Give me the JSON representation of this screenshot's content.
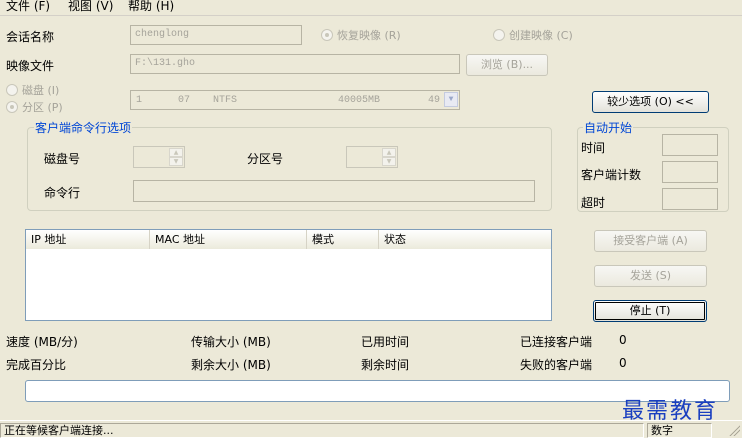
{
  "menu": {
    "file": "文件 (F)",
    "view": "视图 (V)",
    "help": "帮助 (H)"
  },
  "session": {
    "label": "会话名称",
    "value": "chenglong",
    "restore_radio": "恢复映像 (R)",
    "create_radio": "创建映像 (C)"
  },
  "image_file": {
    "label": "映像文件",
    "value": "F:\\131.gho",
    "browse_button": "浏览 (B)..."
  },
  "target": {
    "disk_radio": "磁盘 (I)",
    "partition_radio": "分区 (P)",
    "selection": {
      "index": "1",
      "part": "07",
      "fs": "NTFS",
      "size": "40005MB",
      "extra": "49"
    }
  },
  "less_options_button": "较少选项 (O) <<",
  "client_cmd_group": {
    "title": "客户端命令行选项",
    "disk_no_label": "磁盘号",
    "partition_no_label": "分区号",
    "cmdline_label": "命令行"
  },
  "auto_start_group": {
    "title": "自动开始",
    "time_label": "时间",
    "client_count_label": "客户端计数",
    "timeout_label": "超时"
  },
  "client_list": {
    "columns": [
      "IP 地址",
      "MAC 地址",
      "模式",
      "状态"
    ]
  },
  "buttons": {
    "accept_clients": "接受客户端 (A)",
    "send": "发送 (S)",
    "stop": "停止 (T)"
  },
  "stats": {
    "speed_label": "速度 (MB/分)",
    "transfer_size_label": "传输大小 (MB)",
    "elapsed_label": "已用时间",
    "connected_label": "已连接客户端",
    "connected_value": "0",
    "percent_label": "完成百分比",
    "remaining_size_label": "剩余大小 (MB)",
    "remaining_time_label": "剩余时间",
    "failed_label": "失败的客户端",
    "failed_value": "0"
  },
  "status_bar": {
    "message": "正在等候客户端连接...",
    "mode": "数字"
  },
  "watermark": "最需教育"
}
